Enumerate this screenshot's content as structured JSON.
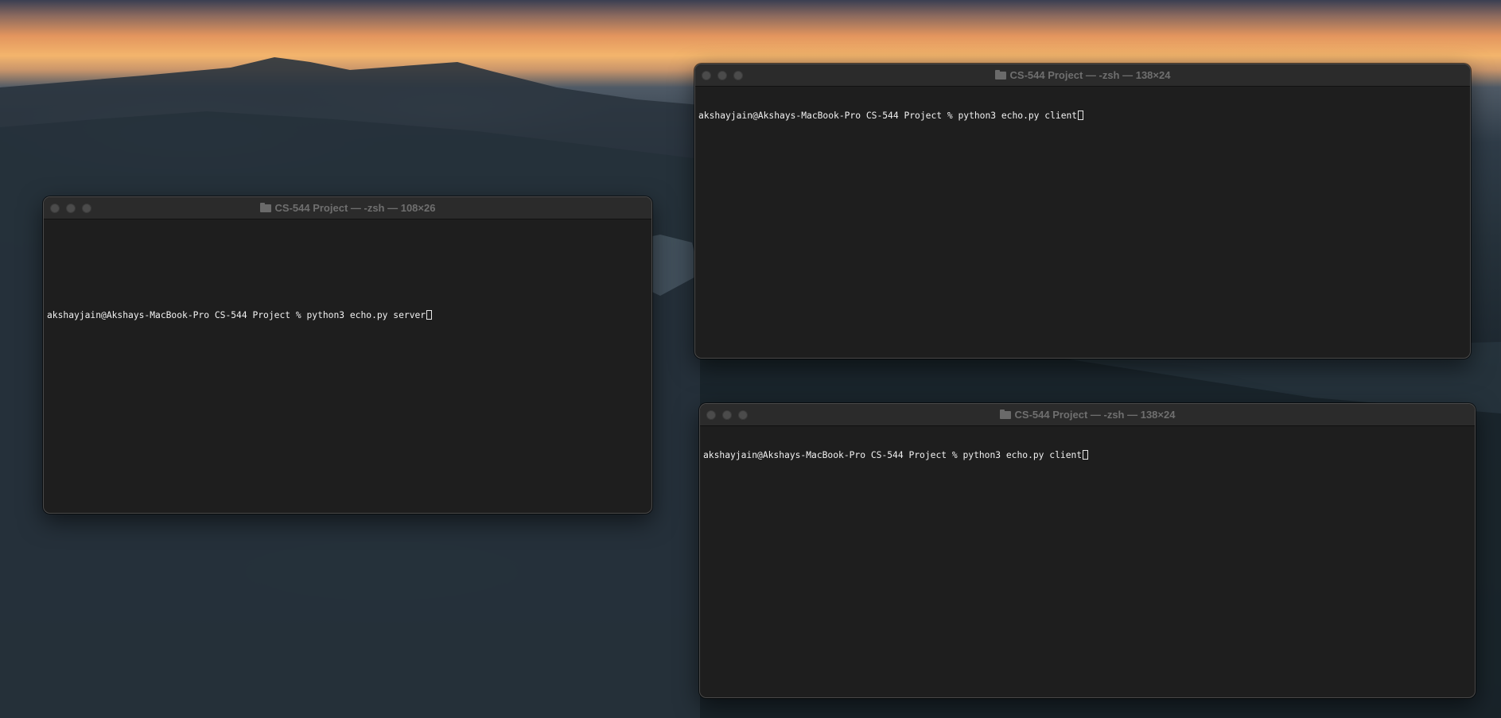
{
  "windows": {
    "server": {
      "title": "CS-544 Project — -zsh — 108×26",
      "prompt": "akshayjain@Akshays-MacBook-Pro CS-544 Project % ",
      "command": "python3 echo.py server"
    },
    "client_top": {
      "title": "CS-544 Project — -zsh — 138×24",
      "prompt": "akshayjain@Akshays-MacBook-Pro CS-544 Project % ",
      "command": "python3 echo.py client"
    },
    "client_bottom": {
      "title": "CS-544 Project — -zsh — 138×24",
      "prompt": "akshayjain@Akshays-MacBook-Pro CS-544 Project % ",
      "command": "python3 echo.py client"
    }
  },
  "icons": {
    "window_title": "folder-icon",
    "window_controls": [
      "close-button-icon",
      "minimize-button-icon",
      "zoom-button-icon"
    ]
  },
  "colors": {
    "terminal_background": "#1e1e1e",
    "titlebar_background": "#2b2b2b",
    "title_text": "#6f6f6f",
    "terminal_text": "#f2f2f2"
  }
}
